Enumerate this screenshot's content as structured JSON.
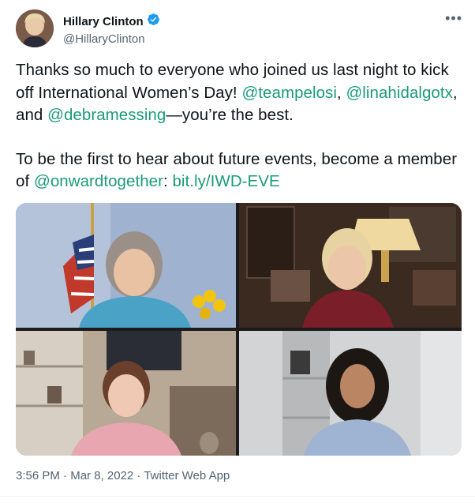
{
  "author": {
    "display_name": "Hillary Clinton",
    "handle": "@HillaryClinton",
    "verified_icon": "verified-badge-icon",
    "more_icon": "more-options-icon"
  },
  "tweet": {
    "p1_part1": "Thanks so much to everyone who joined us last night to kick off International Women’s Day! ",
    "mention1": "@teampelosi",
    "p1_part2": ", ",
    "mention2": "@linahidalgotx",
    "p1_part3": ", and ",
    "mention3": "@debramessing",
    "p1_part4": "—you’re the best.",
    "p2_part1": "To be the first to hear about future events, become a member of ",
    "mention4": "@onwardtogether",
    "p2_part2": ": ",
    "link": "bit.ly/IWD-EVE"
  },
  "meta": {
    "time": "3:56 PM",
    "sep1": " · ",
    "date": "Mar 8, 2022",
    "sep2": " · ",
    "source": "Twitter Web App"
  },
  "colors": {
    "link": "#1a9b78",
    "muted": "#536471",
    "verified": "#1d9bf0"
  }
}
